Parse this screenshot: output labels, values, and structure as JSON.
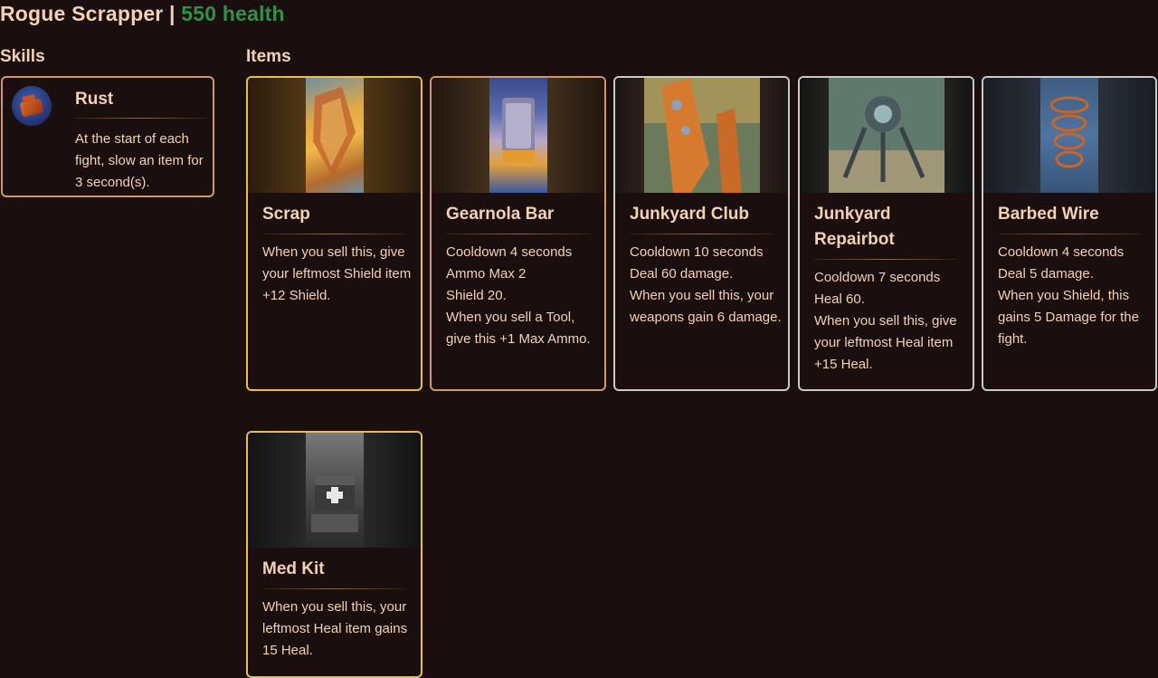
{
  "header": {
    "name": "Rogue Scrapper",
    "separator": " | ",
    "health": "550 health"
  },
  "skills_title": "Skills",
  "items_title": "Items",
  "skills": [
    {
      "name": "Rust",
      "icon": "rust-icon",
      "description": "At the start of each fight, slow an item for 3 second(s)."
    }
  ],
  "items": [
    {
      "name": "Scrap",
      "tier": "gold",
      "icon": "scrap-icon",
      "lines": [
        "When you sell this, give your leftmost Shield item +12 Shield."
      ]
    },
    {
      "name": "Gearnola Bar",
      "tier": "bronze",
      "icon": "gearnola-bar-icon",
      "lines": [
        "Cooldown 4 seconds",
        "Ammo Max 2",
        "Shield 20.",
        "When you sell a Tool, give this +1 Max Ammo."
      ]
    },
    {
      "name": "Junkyard Club",
      "tier": "silver",
      "icon": "junkyard-club-icon",
      "lines": [
        "Cooldown 10 seconds",
        "Deal 60 damage.",
        "When you sell this, your weapons gain 6 damage."
      ]
    },
    {
      "name": "Junkyard Repairbot",
      "tier": "silver",
      "icon": "repairbot-icon",
      "lines": [
        "Cooldown 7 seconds",
        "Heal 60.",
        "When you sell this, give your leftmost Heal item +15 Heal."
      ]
    },
    {
      "name": "Barbed Wire",
      "tier": "silver",
      "icon": "barbed-wire-icon",
      "lines": [
        "Cooldown 4 seconds",
        "Deal 5 damage.",
        "When you Shield, this gains 5 Damage for the fight."
      ]
    },
    {
      "name": "Med Kit",
      "tier": "gold",
      "icon": "med-kit-icon",
      "lines": [
        "When you sell this, your leftmost Heal item gains 15 Heal."
      ]
    }
  ]
}
